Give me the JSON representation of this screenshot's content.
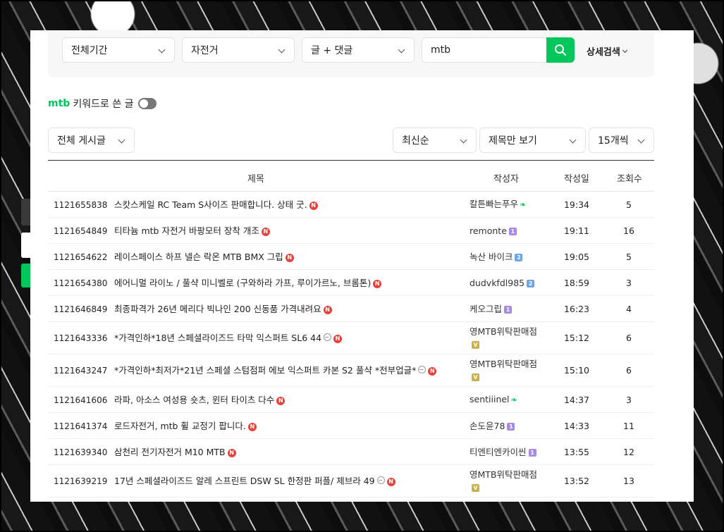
{
  "filters": {
    "period": "전체기간",
    "board": "자전거",
    "scope": "글 + 댓글",
    "query": "mtb",
    "advanced": "상세검색"
  },
  "keyword_toggle": {
    "keyword": "mtb",
    "label": "키워드로 쓴 글",
    "on": false
  },
  "list_controls": {
    "board_select": "전체 게시글",
    "sort": "최신순",
    "view": "제목만 보기",
    "per_page": "15개씩"
  },
  "table": {
    "headers": {
      "title": "제목",
      "author": "작성자",
      "date": "작성일",
      "views": "조회수"
    },
    "rows": [
      {
        "no": "1121655838",
        "title": "스캇스케일 RC Team S사이즈 판매합니다. 상태 굿.",
        "img": false,
        "author": "칼튼빠는푸우",
        "badge": "sprout",
        "date": "19:34",
        "views": "5"
      },
      {
        "no": "1121654849",
        "title": "티타늄 mtb 자전거 바팡모터 장착 개조",
        "img": false,
        "author": "remonte",
        "badge": "1",
        "date": "19:11",
        "views": "16"
      },
      {
        "no": "1121654622",
        "title": "레이스페이스 하프 넬슨 락온 MTB BMX 그립",
        "img": false,
        "author": "녹산 바이크",
        "badge": "2",
        "date": "19:05",
        "views": "5"
      },
      {
        "no": "1121654380",
        "title": "에어니멀 라이노 / 풀샥 미니벨로 (구와하라 가프, 루이가르노, 브롬톤)",
        "img": false,
        "author": "dudvkfdl985",
        "badge": "2",
        "date": "18:59",
        "views": "3"
      },
      {
        "no": "1121646849",
        "title": "최종파격가 26년 메리다 빅나인 200 신동품 가격내려요",
        "img": false,
        "author": "케오그립",
        "badge": "1",
        "date": "16:23",
        "views": "4"
      },
      {
        "no": "1121643336",
        "title": "*가격인하*18년 스페셜라이즈드 타막 익스퍼트 SL6 44",
        "img": true,
        "author": "영MTB위탁판매점",
        "badge": "V",
        "date": "15:12",
        "views": "6"
      },
      {
        "no": "1121643247",
        "title": "*가격인하*최저가*21년 스페셜 스텀점퍼 에보 익스퍼트 카본 S2 풀샥 *전부업글*",
        "img": true,
        "author": "영MTB위탁판매점",
        "badge": "V",
        "date": "15:10",
        "views": "6"
      },
      {
        "no": "1121641606",
        "title": "라파, 아소스 여성용 숏츠, 윈터 타이츠 다수",
        "img": false,
        "author": "sentiiinel",
        "badge": "sprout",
        "date": "14:37",
        "views": "3"
      },
      {
        "no": "1121641374",
        "title": "로드자전거, mtb 휠 교정기 팝니다.",
        "img": false,
        "author": "손도윤78",
        "badge": "1",
        "date": "14:33",
        "views": "11"
      },
      {
        "no": "1121639340",
        "title": "삼천리 전기자전거 M10 MTB",
        "img": false,
        "author": "티엔티엔카이씬",
        "badge": "1",
        "date": "13:55",
        "views": "12"
      },
      {
        "no": "1121639219",
        "title": "17년 스페셜라이즈드 알레 스프린트 DSW SL 한정판 퍼플/ 제브라 49",
        "img": true,
        "author": "영MTB위탁판매점",
        "badge": "V",
        "date": "13:52",
        "views": "13"
      }
    ]
  },
  "icons": {
    "search": "search-icon",
    "new": "new-badge-icon",
    "image": "image-icon",
    "sprout": "sprout-icon"
  },
  "colors": {
    "accent": "#03c75a",
    "new_badge": "#e8413c"
  }
}
